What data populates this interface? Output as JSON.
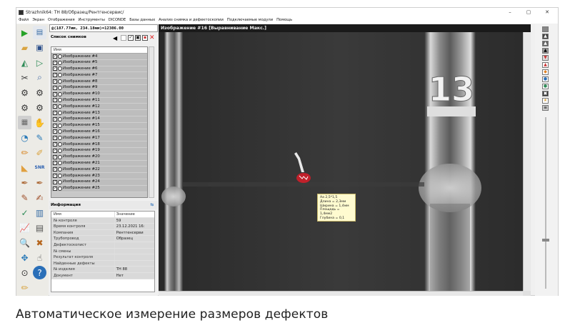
{
  "window": {
    "title": "Strazhnik64: ТН 88/Образец/Рентгенсервис/",
    "controls": {
      "minimize": "–",
      "maximize": "▢",
      "close": "✕"
    }
  },
  "menu": [
    "Файл",
    "Экран",
    "Отображения",
    "Инструменты",
    "DICONDE",
    "Базы данных",
    "Анализ снимка и дефектоскопии",
    "Подключаемые модули",
    "Помощь"
  ],
  "coordinates": "@(187.77мм, 234.18мм)=12306.00",
  "list_panel": {
    "title": "Список снимков",
    "column_header": "Имя",
    "items": [
      "Изображение #4",
      "Изображение #5",
      "Изображение #6",
      "Изображение #7",
      "Изображение #8",
      "Изображение #9",
      "Изображение #10",
      "Изображение #11",
      "Изображение #12",
      "Изображение #13",
      "Изображение #14",
      "Изображение #15",
      "Изображение #16",
      "Изображение #17",
      "Изображение #18",
      "Изображение #19",
      "Изображение #20",
      "Изображение #21",
      "Изображение #22",
      "Изображение #23",
      "Изображение #24",
      "Изображение #25"
    ]
  },
  "info_panel": {
    "title": "Информация",
    "col_name": "Имя",
    "col_value": "Значение",
    "rows": [
      {
        "k": "№ контроля",
        "v": "59"
      },
      {
        "k": "Время контроля",
        "v": "23.12.2021 16:"
      },
      {
        "k": "Компания",
        "v": "Рентгенсерви"
      },
      {
        "k": "Трубопровод",
        "v": "Образец"
      },
      {
        "k": "Дефектоскопист",
        "v": ""
      },
      {
        "k": "№ смены",
        "v": ""
      },
      {
        "k": "Результат контроля",
        "v": ""
      },
      {
        "k": "Найденные дефекты",
        "v": ""
      },
      {
        "k": "№ изделия",
        "v": "ТН 88"
      },
      {
        "k": "Документ",
        "v": "Нет"
      }
    ]
  },
  "image_panel": {
    "title": "Изображение #16 [Выравнивание Макс.]",
    "marker_text": "13"
  },
  "measurement": {
    "lines": [
      "Аа 2,5*1,5",
      "Длина = 2,3мм",
      "Ширина = 1,4мм",
      "Площадь = 1,4мм2",
      "Глубина = 0,1"
    ]
  },
  "left_toolbar_label": "SNR",
  "caption": "Автоматическое измерение размеров дефектов",
  "colors": {
    "defect": "#c0202a",
    "tooltip_bg": "#fffbd0",
    "image_title_bg": "#1a1a1a"
  }
}
